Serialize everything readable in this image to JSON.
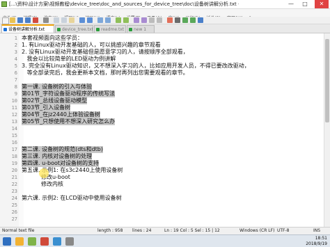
{
  "window": {
    "title": "[...\\资料\\设计方案\\视频教程\\device_tree\\doc_and_sources_for_device_tree\\doc\\设备树讲解分析.txt - Notepad++ [Administrator]",
    "controls": [
      "—",
      "□",
      "✕"
    ]
  },
  "menu": [
    "文件(F)",
    "编辑(E)",
    "搜索(S)",
    "视图(V)",
    "编码(N)",
    "语言(L)",
    "设置(T)",
    "工具(O)",
    "宏(M)",
    "运行(R)",
    "插件(P)",
    "窗口(W)",
    "?"
  ],
  "tabs": [
    {
      "label": "设备树讲解分析.txt",
      "active": true,
      "color": "#1b6fd6"
    },
    {
      "label": "device_tree.txt",
      "active": false,
      "color": "#2a9d3c"
    },
    {
      "label": "readme.txt",
      "active": false,
      "color": "#2a9d3c"
    },
    {
      "label": "new 1",
      "active": false,
      "color": "#2a9d3c"
    }
  ],
  "editor": {
    "lines": [
      {
        "n": "1",
        "text": "本套视频面向这些学员：",
        "hl": false
      },
      {
        "n": "2",
        "text": "1. 有Linux驱动开发基础的人，可以挑感兴趣的章节观看",
        "hl": false
      },
      {
        "n": "3",
        "text": "2. 没有Linux驱动开发基础但是愿意学习的人，请按顺序全部观看，",
        "hl": false
      },
      {
        "n": "4",
        "text": "   我会以比较简单的LED驱动为例讲解",
        "hl": false
      },
      {
        "n": "5",
        "text": "3. 完全没有Linux驱动知识，又不想深入学习的人，比如应用开发人员，不得已要改改驱动，",
        "hl": false
      },
      {
        "n": "6",
        "text": "   等全部录完后，我会更新本文档，那时再列出您需要观看的章节。",
        "hl": false
      },
      {
        "n": "7",
        "text": "",
        "hl": false
      },
      {
        "n": "8",
        "text": "第一课. 设备树的引入与体验",
        "hl": true
      },
      {
        "n": "9",
        "text": "第01节_字符设备驱动程序的传统写法",
        "hl": true
      },
      {
        "n": "10",
        "text": "第02节_总线设备驱动模型",
        "hl": true
      },
      {
        "n": "11",
        "text": "第03节_引入设备树",
        "hl": true
      },
      {
        "n": "12",
        "text": "第04节_在jz2440上体验设备树",
        "hl": true
      },
      {
        "n": "13",
        "text": "第05节_只想使用不想深入研究怎么办",
        "hl": true
      },
      {
        "n": "14",
        "text": "",
        "hl": false
      },
      {
        "n": "15",
        "text": "",
        "hl": false
      },
      {
        "n": "16",
        "text": "",
        "hl": false
      },
      {
        "n": "17",
        "text": "第二课. 设备树的规范(dts和dtb)",
        "hl": true
      },
      {
        "n": "18",
        "text": "第三课. 内核对设备树的处理",
        "hl": true
      },
      {
        "n": "19",
        "text": "第四课. u-boot对设备树的支持",
        "hl": true
      },
      {
        "n": "20",
        "text": "第五课. 示例1: 在s3c2440上使用设备树",
        "hl": false
      },
      {
        "n": "21",
        "text": "           修改u-boot",
        "hl": false
      },
      {
        "n": "22",
        "text": "           修改内核",
        "hl": false
      },
      {
        "n": "23",
        "text": "",
        "hl": false
      },
      {
        "n": "24",
        "text": "第六课. 示例2: 在LCD驱动中使用设备树",
        "hl": false
      },
      {
        "n": "25",
        "text": "",
        "hl": false
      },
      {
        "n": "26",
        "text": "",
        "hl": false
      },
      {
        "n": "27",
        "text": "",
        "hl": false
      }
    ]
  },
  "status": {
    "type": "Normal text file",
    "length": "length : 958",
    "lines": "lines : 24",
    "position": "Ln : 19    Col : 5    Sel : 15 | 12",
    "eol": "Windows (CR LF)",
    "encoding": "UTF-8",
    "mode": "INS"
  },
  "taskbar": {
    "time": "18:51",
    "date": "2018/9/19",
    "apps": [
      "#2e6fc0",
      "#f2b233",
      "#7fb34a",
      "#d04a3a",
      "#3a8fd0",
      "#888888"
    ]
  },
  "colors": {
    "highlight": "#c8c8c8",
    "active_tab_accent": "#f0a30a"
  }
}
